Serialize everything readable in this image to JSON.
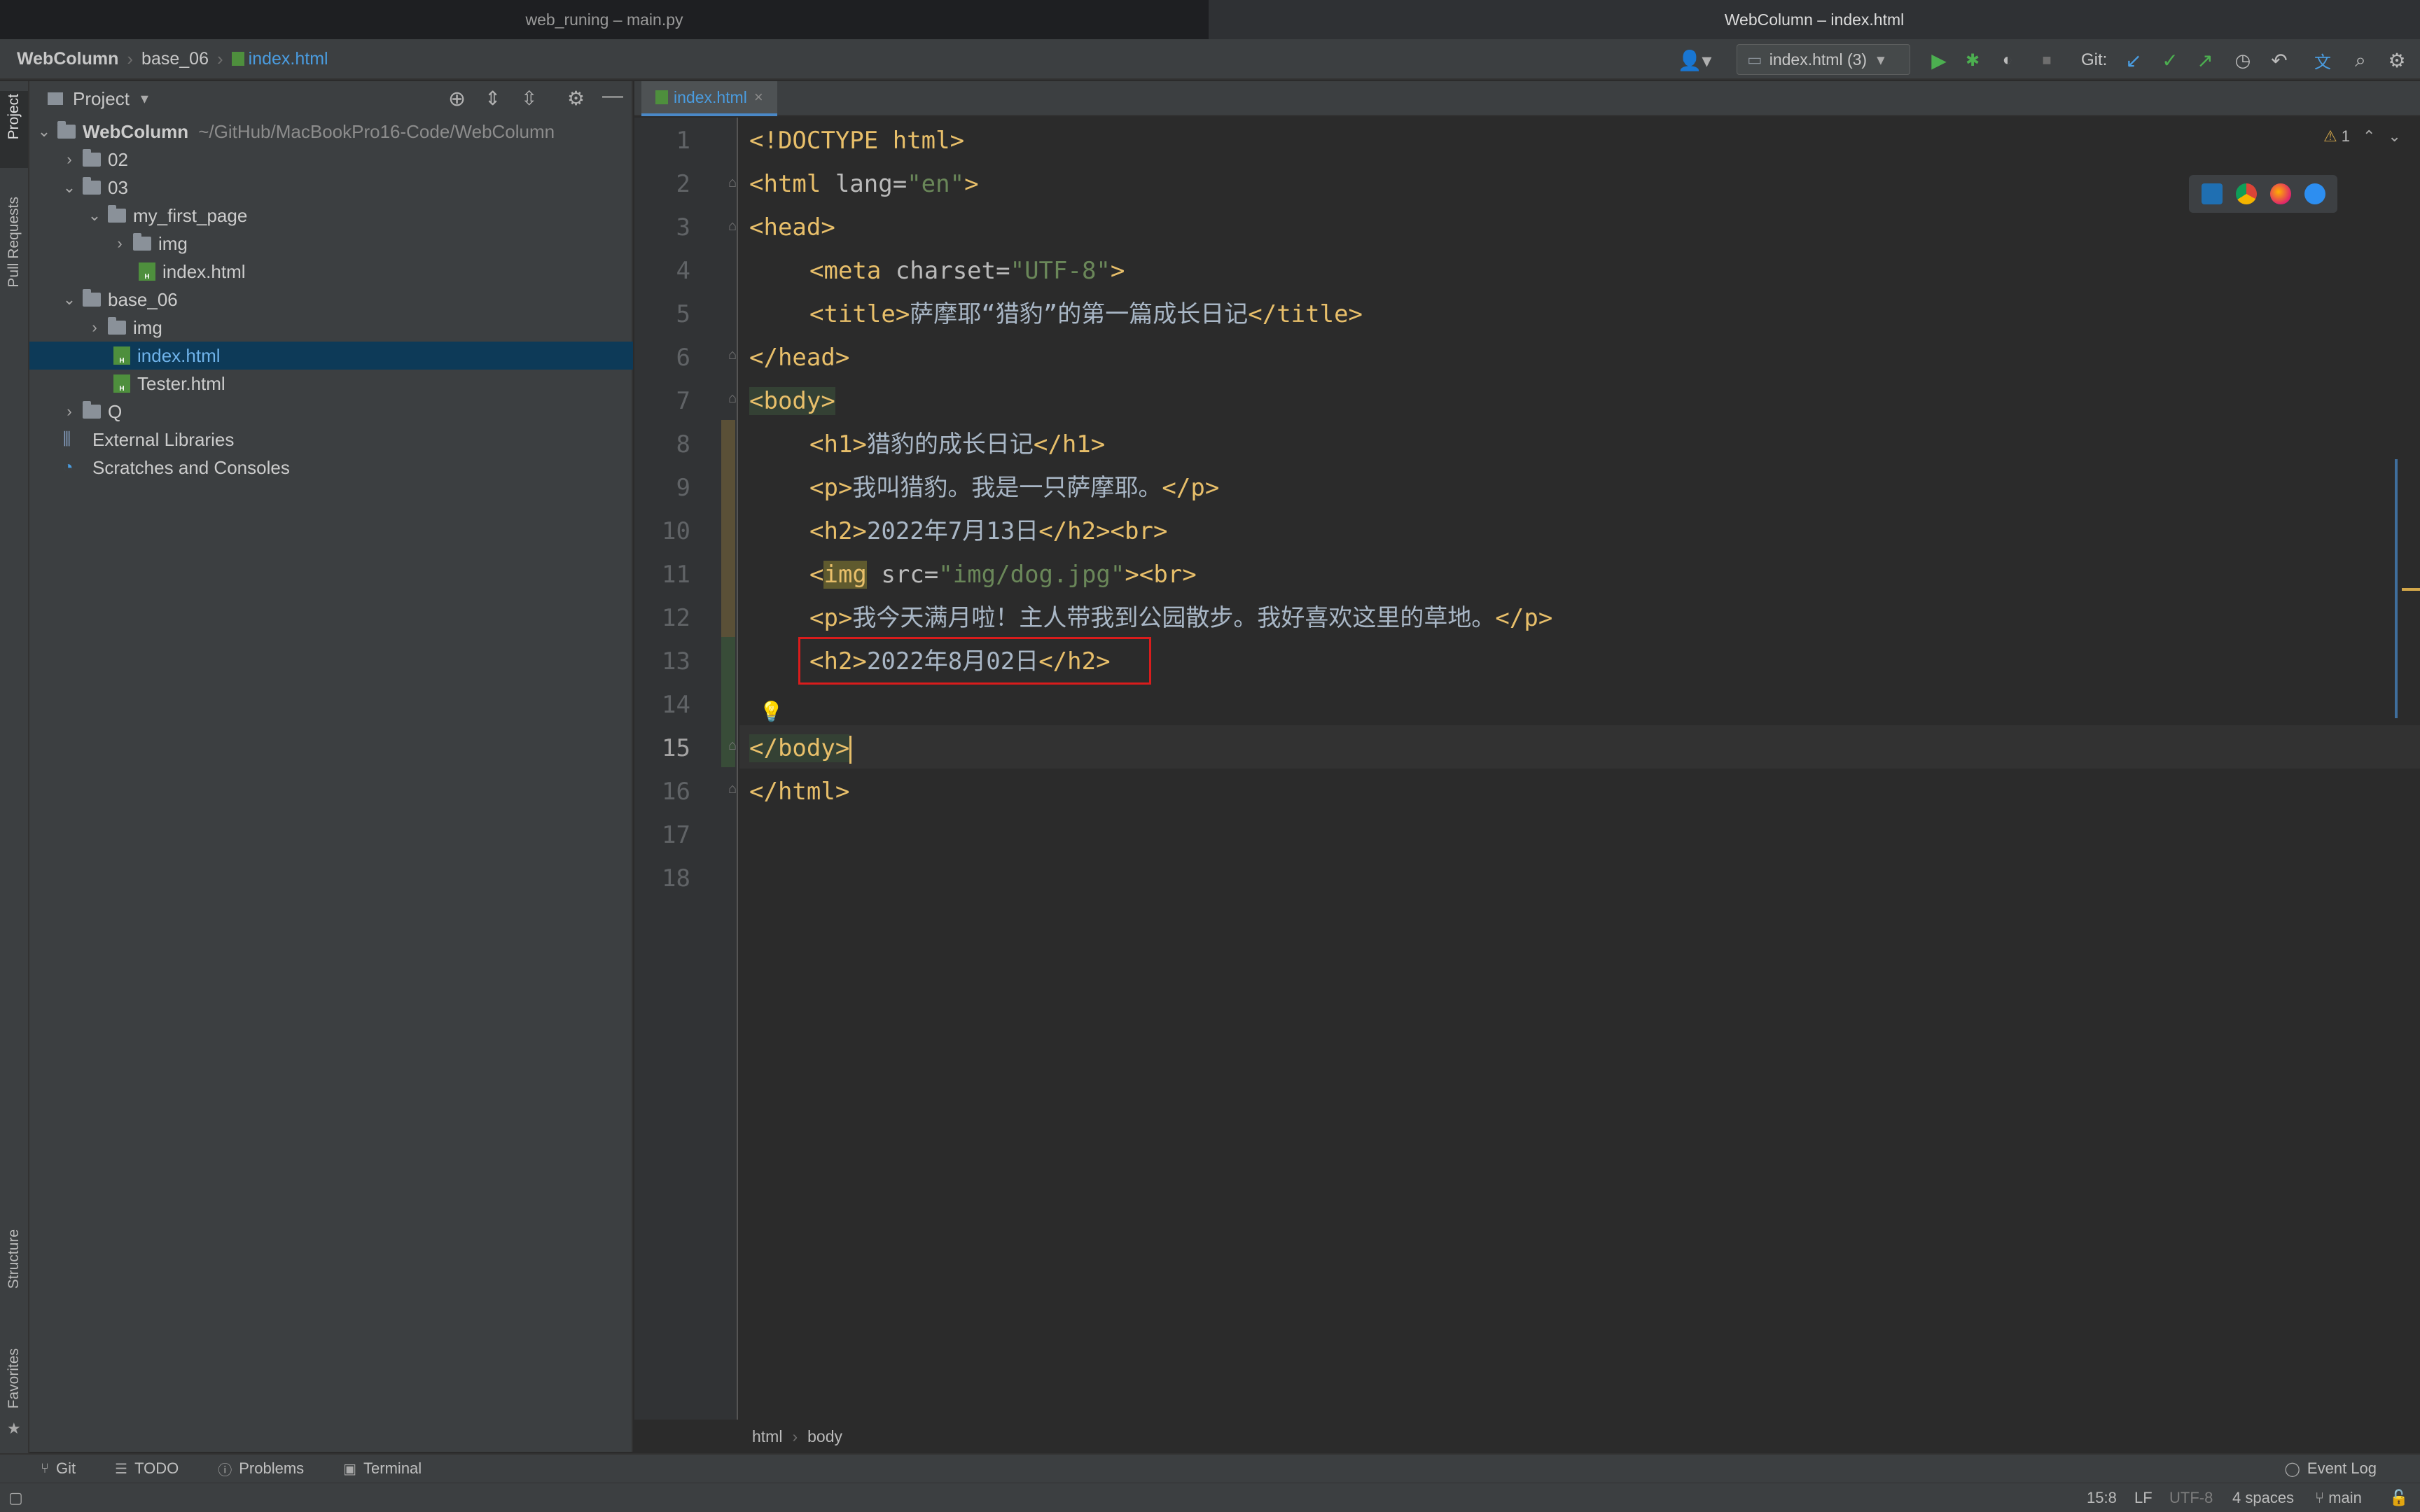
{
  "window": {
    "tab_left": "web_runing – main.py",
    "tab_right": "WebColumn – index.html"
  },
  "navbar": {
    "crumbs": [
      "WebColumn",
      "base_06",
      "index.html"
    ],
    "run_config": "index.html (3)",
    "git_label": "Git:"
  },
  "left_strip": {
    "project": "Project",
    "pull_requests": "Pull Requests",
    "structure": "Structure",
    "favorites": "Favorites"
  },
  "project_panel": {
    "title": "Project",
    "root_name": "WebColumn",
    "root_path": "~/GitHub/MacBookPro16-Code/WebColumn",
    "items": [
      {
        "label": "02"
      },
      {
        "label": "03"
      },
      {
        "label": "my_first_page"
      },
      {
        "label": "img"
      },
      {
        "label": "index.html"
      },
      {
        "label": "base_06"
      },
      {
        "label": "img"
      },
      {
        "label": "index.html"
      },
      {
        "label": "Tester.html"
      },
      {
        "label": "Q"
      },
      {
        "label": "External Libraries"
      },
      {
        "label": "Scratches and Consoles"
      }
    ]
  },
  "editor": {
    "tab_label": "index.html",
    "warning_count": "1",
    "line_numbers": [
      "1",
      "2",
      "3",
      "4",
      "5",
      "6",
      "7",
      "8",
      "9",
      "10",
      "11",
      "12",
      "13",
      "14",
      "15",
      "16",
      "17",
      "18"
    ],
    "current_line": "15",
    "lines": {
      "l1": "<!DOCTYPE html>",
      "l2_open": "<html ",
      "l2_attr": "lang=",
      "l2_val": "\"en\"",
      "l2_close": ">",
      "l3": "<head>",
      "l4_open": "<meta ",
      "l4_attr": "charset=",
      "l4_val": "\"UTF-8\"",
      "l4_close": ">",
      "l5_open": "<title>",
      "l5_text": "萨摩耶“猎豹”的第一篇成长日记",
      "l5_close": "</title>",
      "l6": "</head>",
      "l7": "<body>",
      "l8_open": "<h1>",
      "l8_text": "猎豹的成长日记",
      "l8_close": "</h1>",
      "l9_open": "<p>",
      "l9_text": "我叫猎豹。我是一只萨摩耶。",
      "l9_close": "</p>",
      "l10_open": "<h2>",
      "l10_text": "2022年7月13日",
      "l10_close": "</h2><br>",
      "l11_lt": "<",
      "l11_tag": "img",
      "l11_attr": " src=",
      "l11_val": "\"img/dog.jpg\"",
      "l11_close": "><br>",
      "l12_open": "<p>",
      "l12_text": "我今天满月啦！主人带我到公园散步。我好喜欢这里的草地。",
      "l12_close": "</p>",
      "l13_open": "<h2>",
      "l13_text": "2022年8月02日",
      "l13_close": "</h2>",
      "l15": "</body>",
      "l16": "</html>"
    },
    "breadcrumb": [
      "html",
      "body"
    ]
  },
  "bottom_bar": {
    "git": "Git",
    "todo": "TODO",
    "problems": "Problems",
    "terminal": "Terminal",
    "event_log": "Event Log"
  },
  "status_bar": {
    "position": "15:8",
    "line_sep": "LF",
    "encoding": "UTF-8",
    "indent": "4 spaces",
    "branch": "main"
  },
  "colors": {
    "tag": "#e8bf6a",
    "attr_value": "#6a8759",
    "selection": "#0d3a58",
    "highlight_box": "#d91c1c",
    "accent": "#4a9ce0"
  }
}
